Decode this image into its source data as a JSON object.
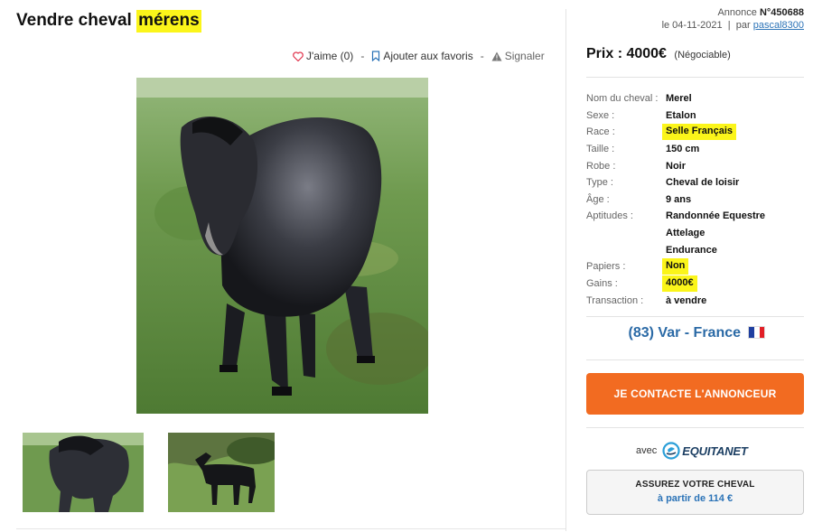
{
  "title": {
    "prefix": "Vendre cheval",
    "highlight": "mérens"
  },
  "actions": {
    "like_label": "J'aime (0)",
    "favorite_label": "Ajouter aux favoris",
    "report_label": "Signaler",
    "separator": "-"
  },
  "annonce": {
    "label": "Annonce",
    "number": "N°450688",
    "date": "le 04-11-2021",
    "separator": "|",
    "by_label": "par",
    "author": "pascal8300"
  },
  "price": {
    "label": "Prix : 4000€",
    "note": "(Négociable)"
  },
  "details": [
    {
      "label": "Nom du cheval :",
      "value": "Merel",
      "highlight": false
    },
    {
      "label": "Sexe :",
      "value": "Etalon",
      "highlight": false
    },
    {
      "label": "Race :",
      "value": "Selle Français",
      "highlight": true
    },
    {
      "label": "Taille :",
      "value": "150 cm",
      "highlight": false
    },
    {
      "label": "Robe :",
      "value": "Noir",
      "highlight": false
    },
    {
      "label": "Type :",
      "value": "Cheval de loisir",
      "highlight": false
    },
    {
      "label": "Âge :",
      "value": "9 ans",
      "highlight": false
    },
    {
      "label": "Aptitudes :",
      "value": "Randonnée Equestre",
      "highlight": false
    },
    {
      "label": "",
      "value": "Attelage",
      "highlight": false
    },
    {
      "label": "",
      "value": "Endurance",
      "highlight": false
    },
    {
      "label": "Papiers :",
      "value": "Non",
      "highlight": true
    },
    {
      "label": "Gains :",
      "value": "4000€",
      "highlight": true
    },
    {
      "label": "Transaction :",
      "value": "à vendre",
      "highlight": false
    }
  ],
  "location": {
    "text": "(83) Var - France",
    "flag_colors": [
      "#1f3fa0",
      "#ffffff",
      "#e21f26"
    ]
  },
  "contact_button": {
    "label": "JE CONTACTE L'ANNONCEUR",
    "color": "#f26b21"
  },
  "partner": {
    "avec_label": "avec",
    "logo_text": "EQUITANET"
  },
  "insurance_button": {
    "line1": "ASSUREZ VOTRE CHEVAL",
    "line2": "à partir de 114 €"
  },
  "colors": {
    "highlight": "#fbf51a",
    "link": "#2b73b7",
    "accent": "#f26b21"
  },
  "icons": [
    "heart-icon",
    "bookmark-icon",
    "warning-icon",
    "equitanet-logo-icon",
    "france-flag-icon"
  ]
}
